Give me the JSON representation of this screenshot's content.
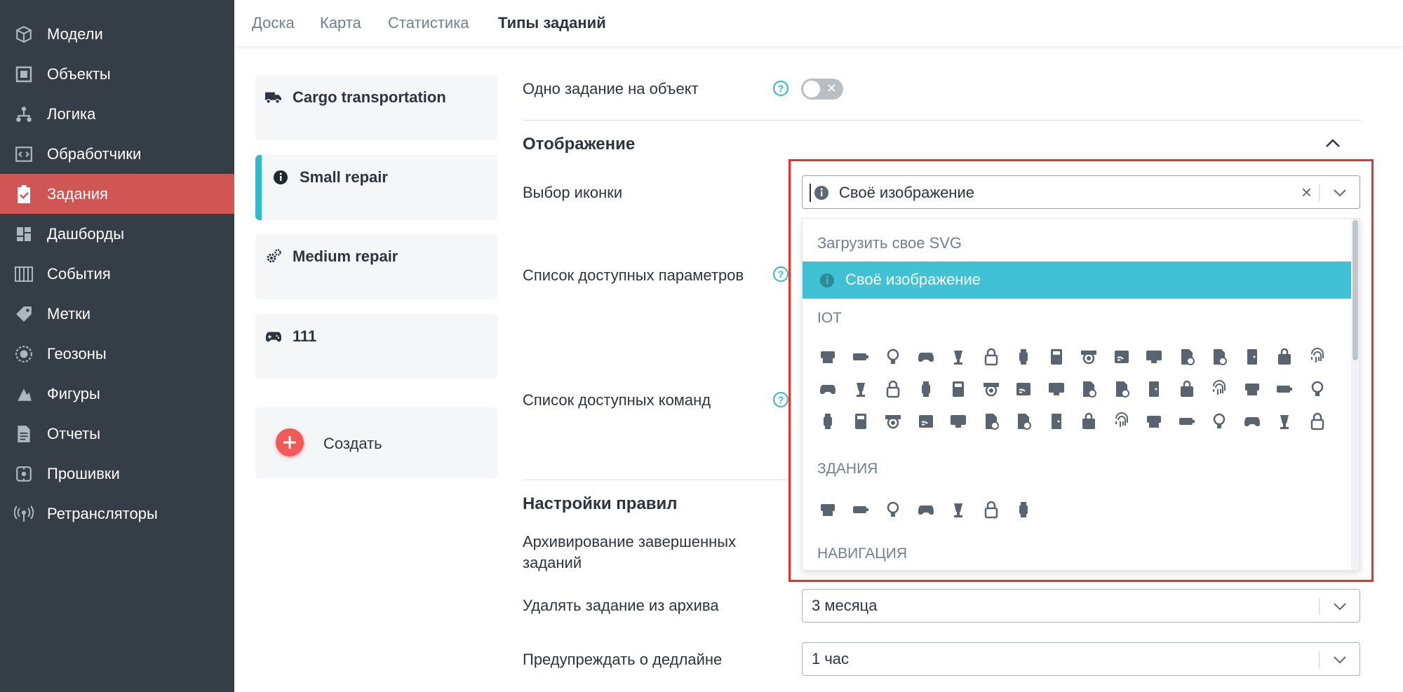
{
  "sidebar": {
    "items": [
      {
        "label": "Модели",
        "icon": "cube-icon"
      },
      {
        "label": "Объекты",
        "icon": "object-icon"
      },
      {
        "label": "Логика",
        "icon": "hierarchy-icon"
      },
      {
        "label": "Обработчики",
        "icon": "code-icon"
      },
      {
        "label": "Задания",
        "icon": "clipboard-check-icon",
        "active": true
      },
      {
        "label": "Дашборды",
        "icon": "dashboard-icon"
      },
      {
        "label": "События",
        "icon": "calendar-columns-icon"
      },
      {
        "label": "Метки",
        "icon": "tag-icon"
      },
      {
        "label": "Геозоны",
        "icon": "globe-icon"
      },
      {
        "label": "Фигуры",
        "icon": "shapes-icon"
      },
      {
        "label": "Отчеты",
        "icon": "document-icon"
      },
      {
        "label": "Прошивки",
        "icon": "firmware-icon"
      },
      {
        "label": "Ретрансляторы",
        "icon": "antenna-icon"
      }
    ]
  },
  "tabs": [
    {
      "label": "Доска"
    },
    {
      "label": "Карта"
    },
    {
      "label": "Статистика"
    },
    {
      "label": "Типы заданий",
      "active": true
    }
  ],
  "task_types": [
    {
      "label": "Cargo transportation",
      "icon": "truck-icon"
    },
    {
      "label": "Small repair",
      "icon": "info-icon",
      "selected": true
    },
    {
      "label": "Medium repair",
      "icon": "gears-icon"
    },
    {
      "label": "111",
      "icon": "gamepad-icon"
    }
  ],
  "create_label": "Создать",
  "form": {
    "one_task_label": "Одно задание на объект",
    "one_task_enabled": false,
    "display_section": "Отображение",
    "icon_choice_label": "Выбор иконки",
    "params_label": "Список доступных параметров",
    "commands_label": "Список доступных команд",
    "rules_section": "Настройки правил",
    "archive_label": "Архивирование завершенных заданий",
    "delete_label": "Удалять задание из архива",
    "delete_value": "3 месяца",
    "deadline_label": "Предупреждать о дедлайне",
    "deadline_value": "1 час",
    "help_glyph": "?"
  },
  "icon_picker": {
    "value": "Своё изображение",
    "upload_label": "Загрузить свое SVG",
    "selected_label": "Своё изображение",
    "groups": {
      "iot": "IOT",
      "buildings": "ЗДАНИЯ",
      "navigation": "НАВИГАЦИЯ"
    },
    "iot_icons": [
      "printer-icon",
      "battery-icon",
      "bulb-icon",
      "gamepad-icon",
      "lamp-icon",
      "lock-icon",
      "smartwatch-icon",
      "calculator-icon",
      "camera-dome-icon",
      "cast-icon",
      "monitor-sound-icon",
      "file-import-icon",
      "file-export-icon",
      "door-icon",
      "door-lock-icon",
      "fingerprint-icon",
      "flashlight-off-icon",
      "flashlight-icon",
      "washer-icon",
      "dryer-icon",
      "joystick-icon",
      "stamp-icon",
      "keyboard-icon",
      "suitcase-icon",
      "microphone-icon",
      "modem-icon",
      "network-icon",
      "plug-icon",
      "power-socket-icon",
      "projector-icon",
      "radar-icon",
      "smartwatch-2-icon",
      "router-icon",
      "rss-icon",
      "shutter-icon",
      "scanner-icon",
      "stopwatch-icon",
      "monitor-message-icon",
      "usb-stick-icon",
      "backpack-icon",
      "smart-lock-icon",
      "fridge-icon",
      "dial-icon",
      "speaker-icon",
      "satellite-icon",
      "server-icon",
      "wifi-icon",
      "gauge-icon"
    ],
    "building_icons": [
      "tower-broadcast-icon",
      "factory-icon",
      "garage-icon",
      "house-icon",
      "office-building-icon",
      "lighthouse-icon",
      "traffic-cone-icon"
    ]
  }
}
